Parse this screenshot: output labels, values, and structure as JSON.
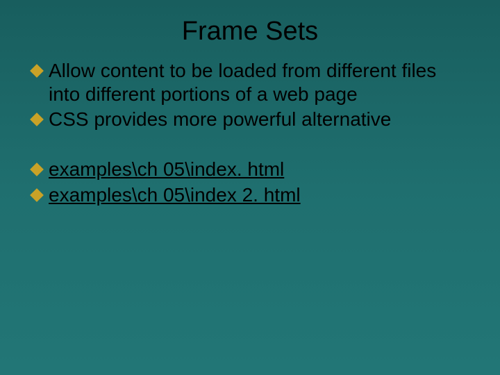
{
  "title": "Frame Sets",
  "bullets": [
    {
      "text": "Allow content to be loaded from different files into different portions of a web page",
      "link": false
    },
    {
      "text": "CSS provides more powerful alternative",
      "link": false
    }
  ],
  "links": [
    {
      "text": "examples\\ch 05\\index. html"
    },
    {
      "text": "examples\\ch 05\\index 2. html"
    }
  ],
  "accent_color": "#c9a227"
}
